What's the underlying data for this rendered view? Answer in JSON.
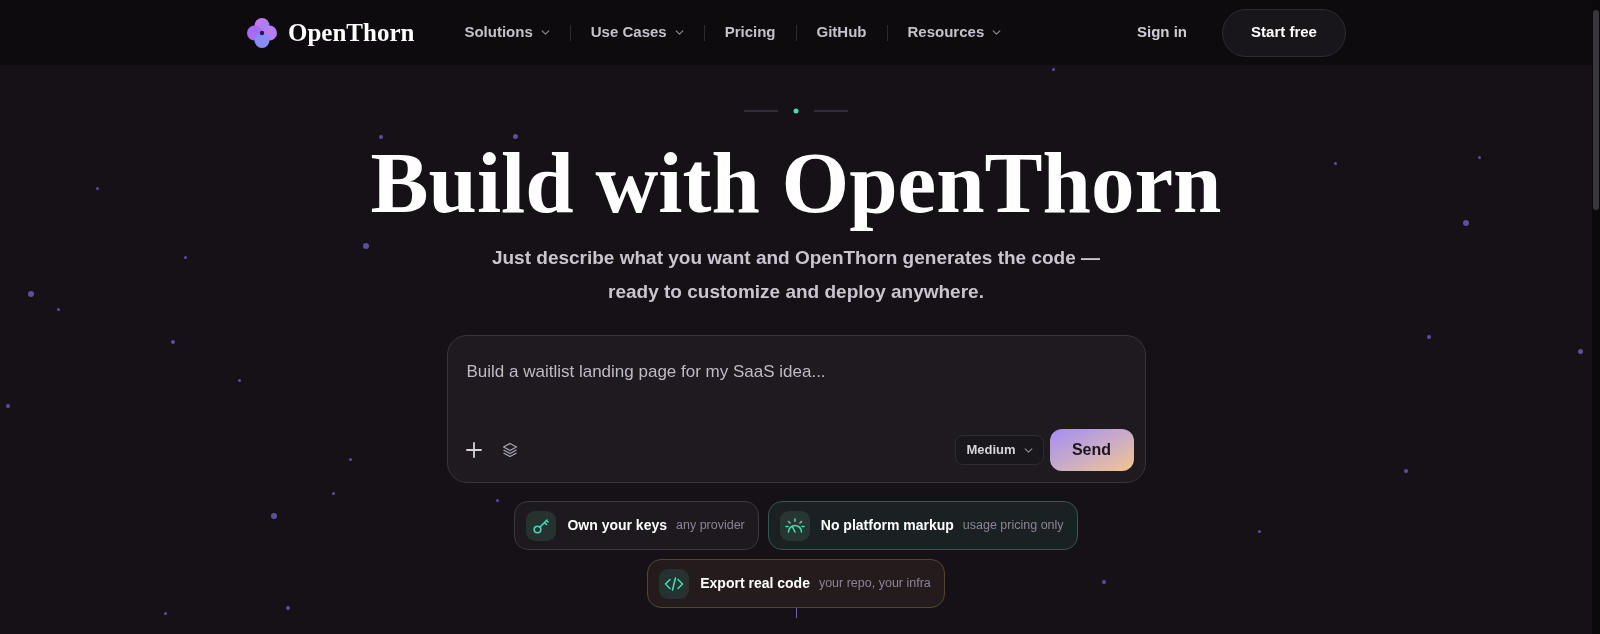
{
  "nav": {
    "brand": "OpenThorn",
    "links": [
      {
        "label": "Solutions",
        "dropdown": true
      },
      {
        "label": "Use Cases",
        "dropdown": true
      },
      {
        "label": "Pricing",
        "dropdown": false
      },
      {
        "label": "GitHub",
        "dropdown": false
      },
      {
        "label": "Resources",
        "dropdown": true
      }
    ],
    "sign_in": "Sign in",
    "cta": "Start free"
  },
  "hero": {
    "title": "Build with OpenThorn",
    "subtitle": "Just describe what you want and OpenThorn generates the code — ready to customize and deploy anywhere."
  },
  "prompt": {
    "placeholder": "Build a waitlist landing page for my SaaS idea...",
    "effort": "Medium",
    "send": "Send"
  },
  "features": [
    {
      "title": "Own your keys",
      "note": "any provider",
      "color": "#3b3640"
    },
    {
      "title": "No platform markup",
      "note": "usage pricing only",
      "color": "#2f5a4f"
    },
    {
      "title": "Export real code",
      "note": "your repo, your infra",
      "color": "#574430"
    }
  ]
}
